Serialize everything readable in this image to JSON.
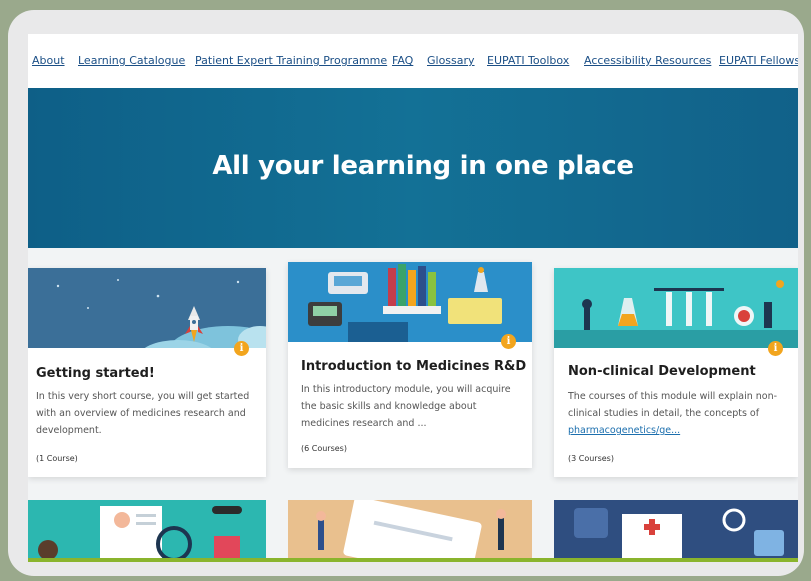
{
  "nav": {
    "items": [
      {
        "label": "About"
      },
      {
        "label": "Learning Catalogue"
      },
      {
        "label": "Patient Expert Training Programme"
      },
      {
        "label": "FAQ"
      },
      {
        "label": "Glossary"
      },
      {
        "label": "EUPATI Toolbox"
      },
      {
        "label": "Accessibility Resources"
      },
      {
        "label": "EUPATI Fellows"
      }
    ]
  },
  "hero": {
    "title": "All your learning in one place"
  },
  "cards": [
    {
      "title": "Getting started!",
      "description": "In this very short course, you will get started with an overview of medicines research and development.",
      "count": "(1 Course)"
    },
    {
      "title": "Introduction to Medicines R&D",
      "description": "In this introductory module, you will acquire the basic skills and knowledge about medicines research and ...",
      "count": "(6 Courses)"
    },
    {
      "title": "Non-clinical Development",
      "description_prefix": "The courses of this module will explain non-clinical studies in detail, the concepts of ",
      "description_link": "pharmacogenetics/ge...",
      "count": "(3 Courses)"
    }
  ],
  "icons": {
    "info": "info-icon"
  },
  "colors": {
    "hero": "#0e5f87",
    "nav_link": "#1b4f86",
    "info_badge": "#f2a51e",
    "accent_green": "#8ab42d"
  }
}
